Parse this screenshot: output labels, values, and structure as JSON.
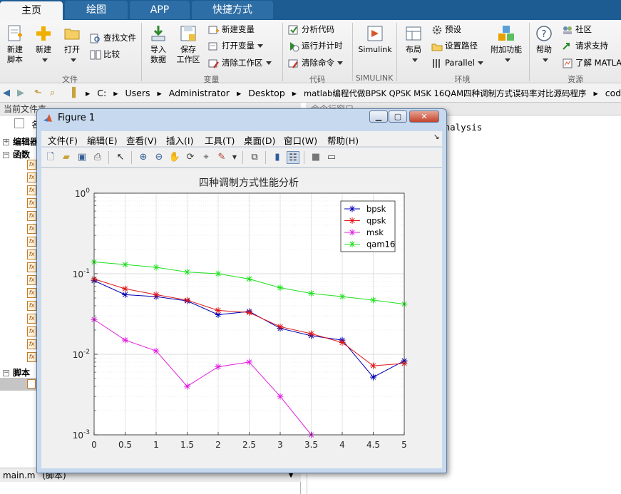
{
  "ribbon_tabs": [
    {
      "label": "主页",
      "active": true
    },
    {
      "label": "绘图",
      "active": false
    },
    {
      "label": "APP",
      "active": false
    },
    {
      "label": "快捷方式",
      "active": false
    }
  ],
  "ribbon": {
    "file": {
      "group_label": "文件",
      "new_script": "新建\n脚本",
      "new": "新建",
      "open": "打开",
      "find_files": "查找文件",
      "compare": "比较"
    },
    "variable": {
      "group_label": "变量",
      "import_data": "导入\n数据",
      "save_workspace": "保存\n工作区",
      "new_variable": "新建变量",
      "open_variable": "打开变量",
      "clear_workspace": "清除工作区"
    },
    "code": {
      "group_label": "代码",
      "analyze_code": "分析代码",
      "run_and_time": "运行并计时",
      "clear_commands": "清除命令"
    },
    "simulink": {
      "group_label": "SIMULINK",
      "simulink": "Simulink"
    },
    "environment": {
      "group_label": "环境",
      "layout": "布局",
      "preferences": "预设",
      "set_path": "设置路径",
      "parallel": "Parallel",
      "add_ons": "附加功能"
    },
    "resources": {
      "group_label": "资源",
      "help": "帮助",
      "community": "社区",
      "request_support": "请求支持",
      "learn_matlab": "了解 MATLAB"
    }
  },
  "address_bar": {
    "path": [
      "C:",
      "Users",
      "Administrator",
      "Desktop",
      "matlab编程代做BPSK QPSK MSK 16QAM四种调制方式误码率对比源码程序",
      "code"
    ]
  },
  "left_panel": {
    "title": "当前文件夹",
    "name_column": "名",
    "sections": {
      "editor": "编辑器",
      "functions": "函数",
      "scripts": "脚本"
    },
    "function_files": 16,
    "details_file": "main.m",
    "details_type": "(脚本)"
  },
  "command_window": {
    "title": "命令行窗口",
    "text": "e Analysis"
  },
  "figure": {
    "title": "Figure 1",
    "menus": [
      "文件(F)",
      "编辑(E)",
      "查看(V)",
      "插入(I)",
      "工具(T)",
      "桌面(D)",
      "窗口(W)",
      "帮助(H)"
    ],
    "toolbar_icons": [
      "new-figure-icon",
      "open-file-icon",
      "save-icon",
      "print-icon",
      "arrow-cursor-icon",
      "zoom-in-icon",
      "zoom-out-icon",
      "pan-hand-icon",
      "rotate-3d-icon",
      "data-cursor-icon",
      "brush-icon",
      "link-plot-icon",
      "colorbar-icon",
      "legend-icon",
      "hide-plot-tools-icon",
      "show-plot-tools-icon"
    ]
  },
  "colors": {
    "tabbar": "#1d5b93",
    "bpsk": "#0000b4",
    "qpsk": "#e01818",
    "msk": "#e020e0",
    "qam16": "#20e020"
  },
  "chart_data": {
    "type": "line",
    "title": "四种调制方式性能分析",
    "xlabel": "",
    "ylabel": "",
    "y_scale": "log",
    "xlim": [
      0,
      5
    ],
    "ylim": [
      0.001,
      1
    ],
    "grid": true,
    "minor_grid": true,
    "legend_position": "top-right",
    "x_ticks": [
      "0",
      "0.5",
      "1",
      "1.5",
      "2",
      "2.5",
      "3",
      "3.5",
      "4",
      "4.5",
      "5"
    ],
    "y_ticks": [
      "10^0",
      "10^-1",
      "10^-2",
      "10^-3"
    ],
    "x": [
      0,
      0.5,
      1,
      1.5,
      2,
      2.5,
      3,
      3.5,
      4,
      4.5,
      5
    ],
    "series": [
      {
        "name": "bpsk",
        "color": "#0000b4",
        "marker": "asterisk",
        "values": [
          0.082,
          0.055,
          0.052,
          0.046,
          0.031,
          0.034,
          0.021,
          0.017,
          0.015,
          0.0052,
          0.0083
        ]
      },
      {
        "name": "qpsk",
        "color": "#e01818",
        "marker": "asterisk",
        "values": [
          0.086,
          0.065,
          0.055,
          0.047,
          0.035,
          0.033,
          0.022,
          0.018,
          0.014,
          0.0072,
          0.0077
        ]
      },
      {
        "name": "msk",
        "color": "#e020e0",
        "marker": "asterisk",
        "values": [
          0.027,
          0.015,
          0.011,
          0.004,
          0.007,
          0.008,
          0.003,
          0.001,
          null,
          null,
          null
        ]
      },
      {
        "name": "qam16",
        "color": "#20e020",
        "marker": "asterisk",
        "values": [
          0.14,
          0.13,
          0.12,
          0.105,
          0.1,
          0.086,
          0.067,
          0.057,
          0.052,
          0.047,
          0.042
        ]
      }
    ]
  }
}
